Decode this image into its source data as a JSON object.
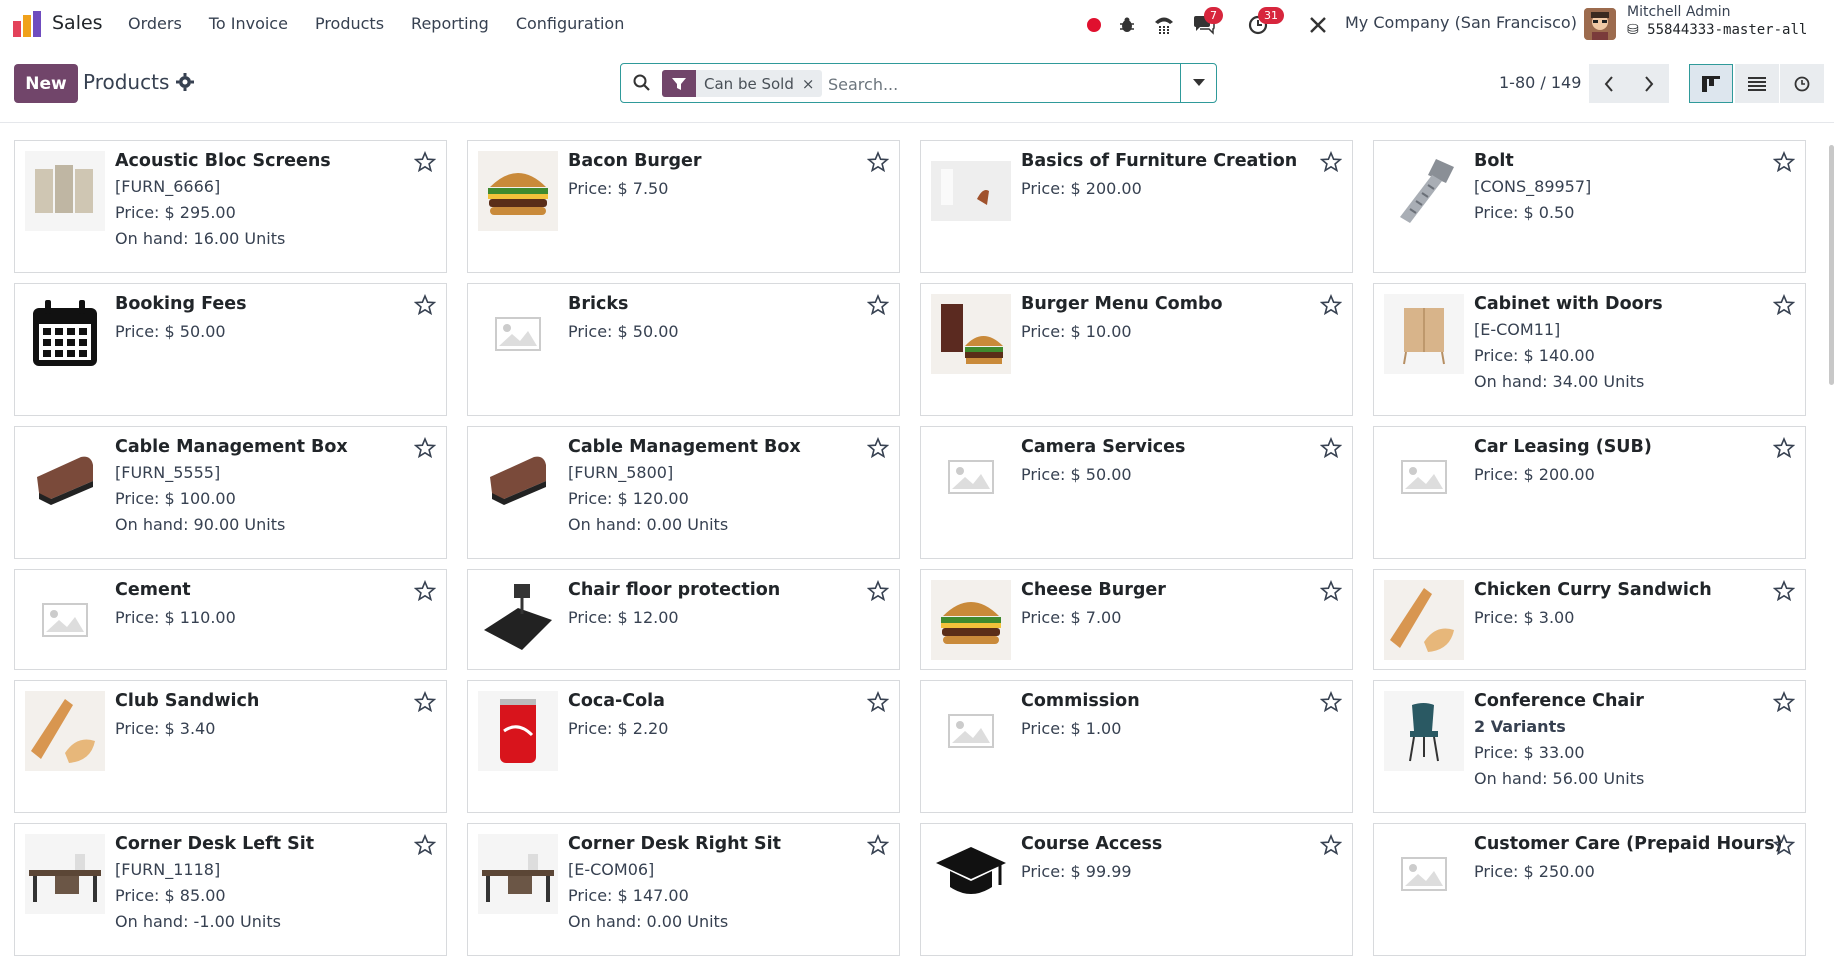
{
  "app": {
    "name": "Sales",
    "menu": [
      "Orders",
      "To Invoice",
      "Products",
      "Reporting",
      "Configuration"
    ],
    "company": "My Company (San Francisco)",
    "user": "Mitchell Admin",
    "database": "55844333-master-all",
    "badges": {
      "messages": "7",
      "activities": "31"
    }
  },
  "control": {
    "new_label": "New",
    "breadcrumb": "Products",
    "facet_label": "Can be Sold",
    "facet_close": "×",
    "search_placeholder": "Search...",
    "pager": "1-80 / 149"
  },
  "products": [
    {
      "name": "Acoustic Bloc Screens",
      "ref": "[FURN_6666]",
      "price": "Price: $ 295.00",
      "onhand": "On hand: 16.00 Units",
      "image": "acoustic-screens-image"
    },
    {
      "name": "Bacon Burger",
      "price": "Price: $ 7.50",
      "image": "burger-image"
    },
    {
      "name": "Basics of Furniture Creation",
      "price": "Price: $ 200.00",
      "image": "furniture-course-image"
    },
    {
      "name": "Bolt",
      "ref": "[CONS_89957]",
      "price": "Price: $ 0.50",
      "image": "bolt-image"
    },
    {
      "name": "Booking Fees",
      "price": "Price: $ 50.00",
      "image": "calendar-icon"
    },
    {
      "name": "Bricks",
      "price": "Price: $ 50.00",
      "image": "placeholder-image"
    },
    {
      "name": "Burger Menu Combo",
      "price": "Price: $ 10.00",
      "image": "burger-combo-image"
    },
    {
      "name": "Cabinet with Doors",
      "ref": "[E-COM11]",
      "price": "Price: $ 140.00",
      "onhand": "On hand: 34.00 Units",
      "image": "cabinet-image"
    },
    {
      "name": "Cable Management Box",
      "ref": "[FURN_5555]",
      "price": "Price: $ 100.00",
      "onhand": "On hand: 90.00 Units",
      "image": "cable-box-image"
    },
    {
      "name": "Cable Management Box",
      "ref": "[FURN_5800]",
      "price": "Price: $ 120.00",
      "onhand": "On hand: 0.00 Units",
      "image": "cable-box-image"
    },
    {
      "name": "Camera Services",
      "price": "Price: $ 50.00",
      "image": "placeholder-image"
    },
    {
      "name": "Car Leasing (SUB)",
      "price": "Price: $ 200.00",
      "image": "placeholder-image"
    },
    {
      "name": "Cement",
      "price": "Price: $ 110.00",
      "image": "placeholder-image"
    },
    {
      "name": "Chair floor protection",
      "price": "Price: $ 12.00",
      "image": "chair-mat-image"
    },
    {
      "name": "Cheese Burger",
      "price": "Price: $ 7.00",
      "image": "burger-image"
    },
    {
      "name": "Chicken Curry Sandwich",
      "price": "Price: $ 3.00",
      "image": "sandwich-image"
    },
    {
      "name": "Club Sandwich",
      "price": "Price: $ 3.40",
      "image": "sandwich-image"
    },
    {
      "name": "Coca-Cola",
      "price": "Price: $ 2.20",
      "image": "cola-can-image"
    },
    {
      "name": "Commission",
      "price": "Price: $ 1.00",
      "image": "placeholder-image"
    },
    {
      "name": "Conference Chair",
      "variants": "2 Variants",
      "price": "Price: $ 33.00",
      "onhand": "On hand: 56.00 Units",
      "image": "chair-image"
    },
    {
      "name": "Corner Desk Left Sit",
      "ref": "[FURN_1118]",
      "price": "Price: $ 85.00",
      "onhand": "On hand: -1.00 Units",
      "image": "desk-image"
    },
    {
      "name": "Corner Desk Right Sit",
      "ref": "[E-COM06]",
      "price": "Price: $ 147.00",
      "onhand": "On hand: 0.00 Units",
      "image": "desk-image"
    },
    {
      "name": "Course Access",
      "price": "Price: $ 99.99",
      "image": "graduation-cap-icon"
    },
    {
      "name": "Customer Care (Prepaid Hours)",
      "price": "Price: $ 250.00",
      "image": "placeholder-image"
    }
  ],
  "colors": {
    "brand": "#71456a",
    "accent": "#2f9a9a",
    "badge": "#d7263d"
  }
}
